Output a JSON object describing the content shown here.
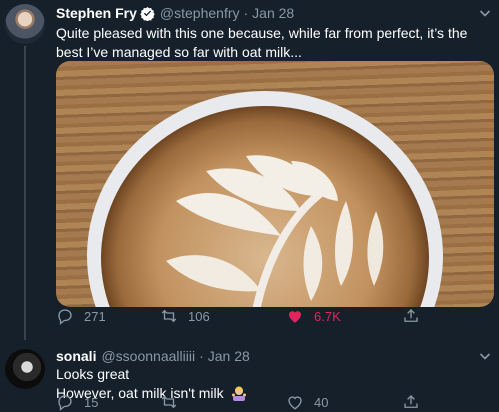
{
  "tweet_main": {
    "author_name": "Stephen Fry",
    "verified": true,
    "handle": "@stephenfry",
    "separator": "·",
    "date": "Jan 28",
    "text": "Quite pleased with this one because, while far from perfect, it’s the best I’ve managed so far with oat milk...",
    "actions": {
      "reply_count": "271",
      "retweet_count": "106",
      "like_count": "6.7K",
      "liked": true
    }
  },
  "tweet_reply": {
    "author_name": "sonali",
    "handle": "@ssoonnaalliiii",
    "separator": "·",
    "date": "Jan 28",
    "text_line1": "Looks great",
    "text_line2": "However, oat milk isn't milk",
    "actions": {
      "reply_count": "15",
      "like_count": "40"
    }
  },
  "colors": {
    "background": "#15202b",
    "secondary_text": "#8899a6",
    "like": "#e0245e",
    "verified": "#ffffff"
  }
}
